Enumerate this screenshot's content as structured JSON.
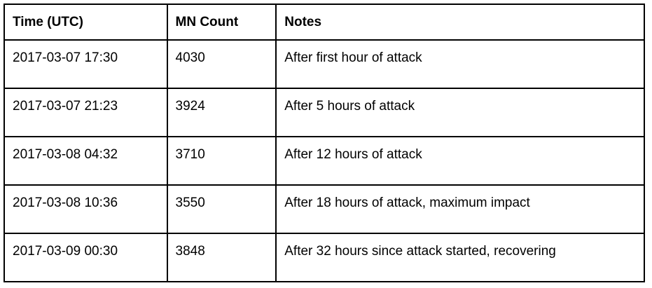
{
  "table": {
    "headers": [
      "Time (UTC)",
      "MN Count",
      "Notes"
    ],
    "rows": [
      [
        "2017-03-07 17:30",
        "4030",
        "After first hour of attack"
      ],
      [
        "2017-03-07 21:23",
        "3924",
        "After 5 hours of attack"
      ],
      [
        "2017-03-08 04:32",
        "3710",
        "After 12 hours of attack"
      ],
      [
        "2017-03-08 10:36",
        "3550",
        "After 18 hours of attack, maximum impact"
      ],
      [
        "2017-03-09 00:30",
        "3848",
        "After 32 hours since attack started, recovering"
      ]
    ]
  }
}
